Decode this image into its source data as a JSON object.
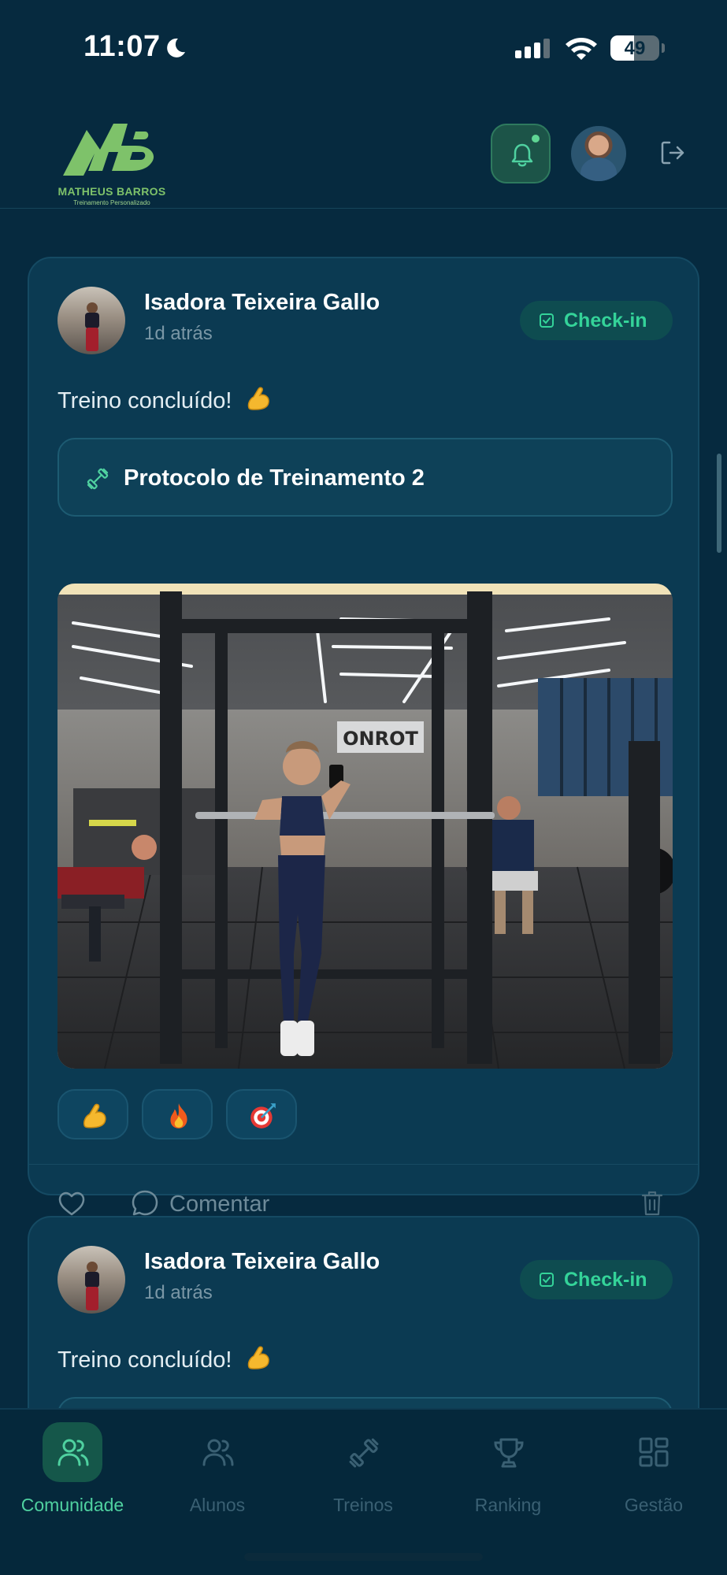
{
  "status_bar": {
    "time": "11:07",
    "battery_percent": "49",
    "battery_level": 0.49
  },
  "header": {
    "logo_name": "MATHEUS BARROS",
    "logo_tagline": "Treinamento Personalizado",
    "notification_dot": true
  },
  "posts": [
    {
      "author": "Isadora Teixeira Gallo",
      "time": "1d atrás",
      "badge": "Check-in",
      "text": "Treino concluído!",
      "protocol": "Protocolo de Treinamento 2",
      "reactions": [
        "flexed-biceps",
        "fire",
        "direct-hit"
      ],
      "comment_label": "Comentar"
    },
    {
      "author": "Isadora Teixeira Gallo",
      "time": "1d atrás",
      "badge": "Check-in",
      "text": "Treino concluído!"
    }
  ],
  "tabs": [
    {
      "label": "Comunidade",
      "icon": "users-icon",
      "active": true
    },
    {
      "label": "Alunos",
      "icon": "user-group-icon",
      "active": false
    },
    {
      "label": "Treinos",
      "icon": "dumbbell-icon",
      "active": false
    },
    {
      "label": "Ranking",
      "icon": "trophy-icon",
      "active": false
    },
    {
      "label": "Gestão",
      "icon": "grid-icon",
      "active": false
    }
  ],
  "colors": {
    "background": "#062a3f",
    "card": "#0b3a52",
    "accent_green": "#34d399",
    "active_tab": "#4fd1a0"
  }
}
